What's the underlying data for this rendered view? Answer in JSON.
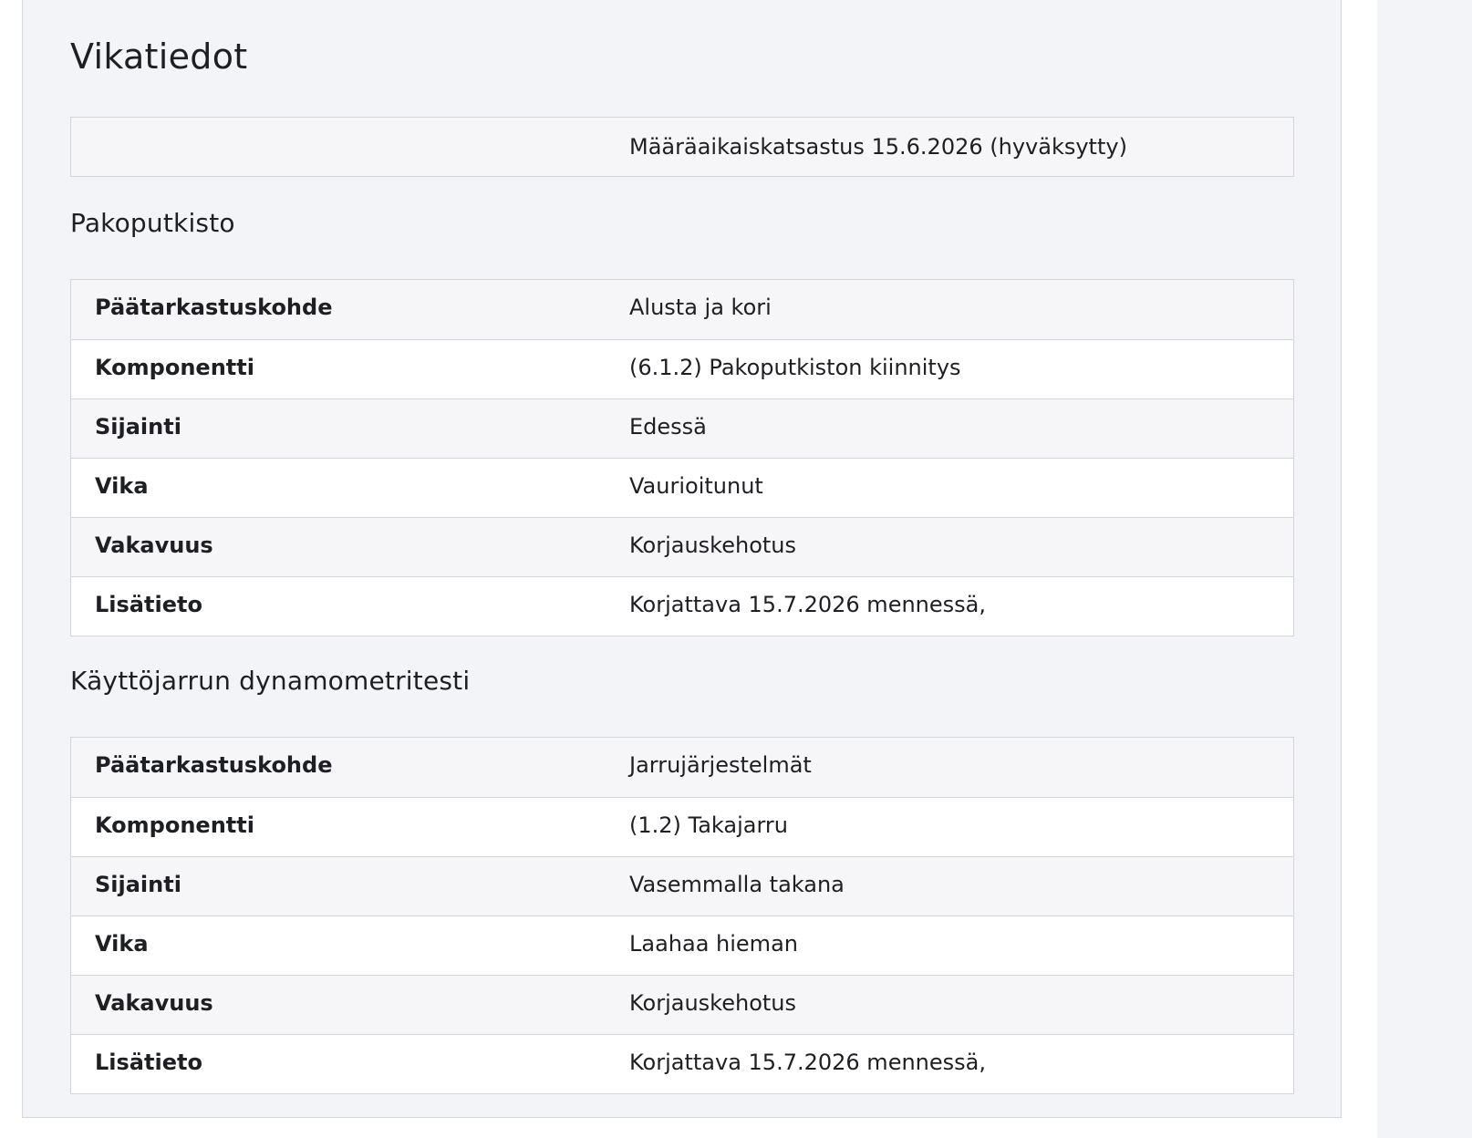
{
  "page": {
    "title": "Vikatiedot",
    "summary": "Määräaikaiskatsastus 15.6.2026 (hyväksytty)"
  },
  "sections": [
    {
      "title": "Pakoputkisto",
      "rows": [
        {
          "label": "Päätarkastuskohde",
          "value": "Alusta ja kori"
        },
        {
          "label": "Komponentti",
          "value": "(6.1.2) Pakoputkiston kiinnitys"
        },
        {
          "label": "Sijainti",
          "value": "Edessä"
        },
        {
          "label": "Vika",
          "value": "Vaurioitunut"
        },
        {
          "label": "Vakavuus",
          "value": "Korjauskehotus"
        },
        {
          "label": "Lisätieto",
          "value": "Korjattava 15.7.2026 mennessä,"
        }
      ]
    },
    {
      "title": "Käyttöjarrun dynamometritesti",
      "rows": [
        {
          "label": "Päätarkastuskohde",
          "value": "Jarrujärjestelmät"
        },
        {
          "label": "Komponentti",
          "value": "(1.2) Takajarru"
        },
        {
          "label": "Sijainti",
          "value": "Vasemmalla takana"
        },
        {
          "label": "Vika",
          "value": "Laahaa hieman"
        },
        {
          "label": "Vakavuus",
          "value": "Korjauskehotus"
        },
        {
          "label": "Lisätieto",
          "value": "Korjattava 15.7.2026 mennessä,"
        }
      ]
    }
  ]
}
